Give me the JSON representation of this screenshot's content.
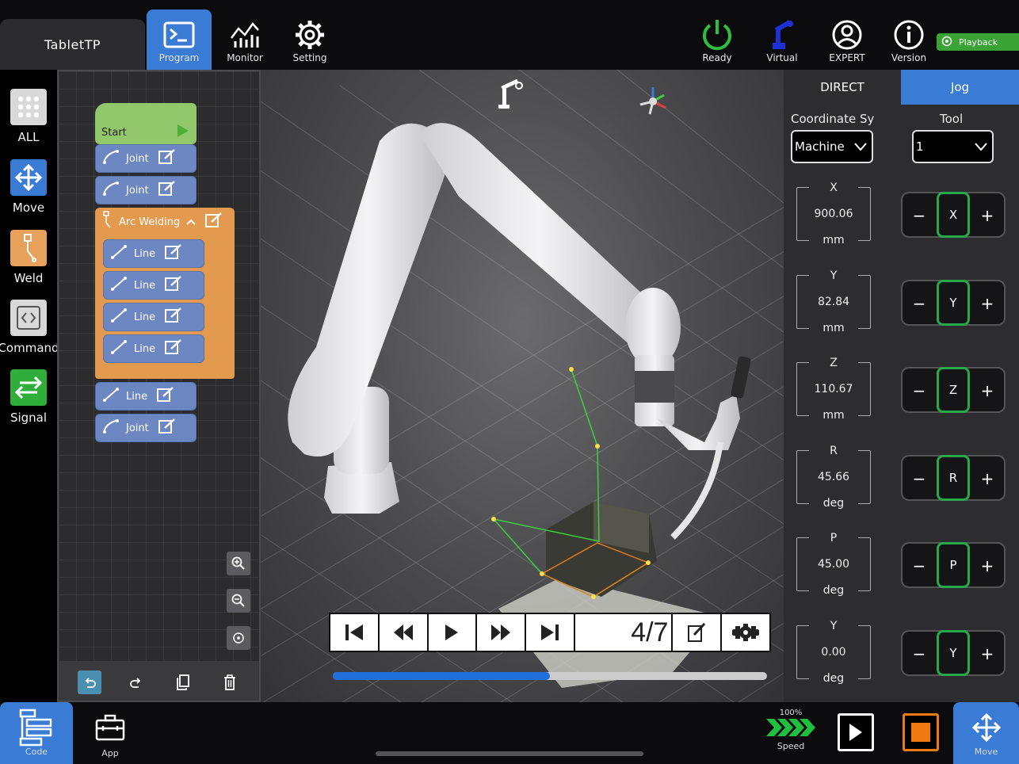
{
  "app": {
    "title": "TabletTP"
  },
  "top_nav": [
    {
      "id": "program",
      "label": "Program",
      "icon": "terminal-icon",
      "active": true
    },
    {
      "id": "monitor",
      "label": "Monitor",
      "icon": "chart-icon"
    },
    {
      "id": "setting",
      "label": "Setting",
      "icon": "gear-icon"
    }
  ],
  "status": {
    "ready": "Ready",
    "virtual": "Virtual",
    "expert": "EXPERT",
    "version": "Version",
    "playback": "Playback"
  },
  "left_nav": [
    {
      "label": "ALL",
      "icon": "grid-icon"
    },
    {
      "label": "Move",
      "icon": "move-arrows-icon"
    },
    {
      "label": "Weld",
      "icon": "weld-torch-icon"
    },
    {
      "label": "Command",
      "icon": "code-brackets-icon"
    },
    {
      "label": "Signal",
      "icon": "signal-arrows-icon"
    }
  ],
  "program_blocks": {
    "start": "Start",
    "joint1": "Joint",
    "joint2": "Joint",
    "arc": "Arc Welding",
    "line1": "Line",
    "line2": "Line",
    "line3": "Line",
    "line4": "Line",
    "line5": "Line",
    "joint3": "Joint"
  },
  "playback": {
    "step": "4/7",
    "progress": 0.5
  },
  "jog_panel": {
    "tab_direct": "DIRECT",
    "tab_jog": "Jog",
    "coord_label": "Coordinate Sy",
    "coord_value": "Machine",
    "tool_label": "Tool",
    "tool_value": "1",
    "axes": [
      {
        "name": "X",
        "value": "900.06",
        "unit": "mm",
        "jog": "X"
      },
      {
        "name": "Y",
        "value": "82.84",
        "unit": "mm",
        "jog": "Y"
      },
      {
        "name": "Z",
        "value": "110.67",
        "unit": "mm",
        "jog": "Z"
      },
      {
        "name": "R",
        "value": "45.66",
        "unit": "deg",
        "jog": "R"
      },
      {
        "name": "P",
        "value": "45.00",
        "unit": "deg",
        "jog": "P"
      },
      {
        "name": "Y",
        "value": "0.00",
        "unit": "deg",
        "jog": "Y"
      }
    ],
    "minus": "−",
    "plus": "+"
  },
  "bottom": {
    "code": "Code",
    "app": "App",
    "speed_value": "100%",
    "speed": "Speed",
    "move": "Move"
  },
  "colors": {
    "accent": "#3a7bd5",
    "ready_green": "#2fbf3f",
    "jog_green": "#27a84a",
    "stop_orange": "#f07a12",
    "block_blue": "#6d87c2",
    "block_orange": "#e3994e",
    "block_green": "#93c76c"
  }
}
